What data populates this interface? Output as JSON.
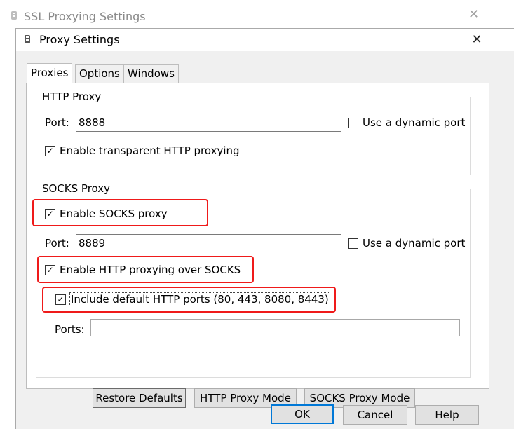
{
  "back_window": {
    "title": "SSL Proxying Settings",
    "close_glyph": "✕"
  },
  "dialog": {
    "title": "Proxy Settings",
    "close_glyph": "✕"
  },
  "tabs": [
    {
      "label": "Proxies",
      "active": true
    },
    {
      "label": "Options",
      "active": false
    },
    {
      "label": "Windows",
      "active": false
    }
  ],
  "http_proxy": {
    "legend": "HTTP Proxy",
    "port_label": "Port:",
    "port_value": "8888",
    "dynamic_port_label": "Use a dynamic port",
    "dynamic_port_checked": false,
    "transparent_label": "Enable transparent HTTP proxying",
    "transparent_checked": true
  },
  "socks_proxy": {
    "legend": "SOCKS Proxy",
    "enable_label": "Enable SOCKS proxy",
    "enable_checked": true,
    "port_label": "Port:",
    "port_value": "8889",
    "dynamic_port_label": "Use a dynamic port",
    "dynamic_port_checked": false,
    "http_over_socks_label": "Enable HTTP proxying over SOCKS",
    "http_over_socks_checked": true,
    "include_default_label": "Include default HTTP ports (80, 443, 8080, 8443)",
    "include_default_checked": true,
    "ports_label": "Ports:",
    "ports_value": ""
  },
  "buttons": {
    "restore_defaults": "Restore Defaults",
    "http_proxy_mode": "HTTP Proxy Mode",
    "socks_proxy_mode": "SOCKS Proxy Mode",
    "ok": "OK",
    "cancel": "Cancel",
    "help": "Help"
  },
  "check_glyph": "✓",
  "colors": {
    "highlight_red": "#ef1a1a",
    "focus_blue": "#0078d7",
    "dialog_bg": "#f0f0f0"
  }
}
